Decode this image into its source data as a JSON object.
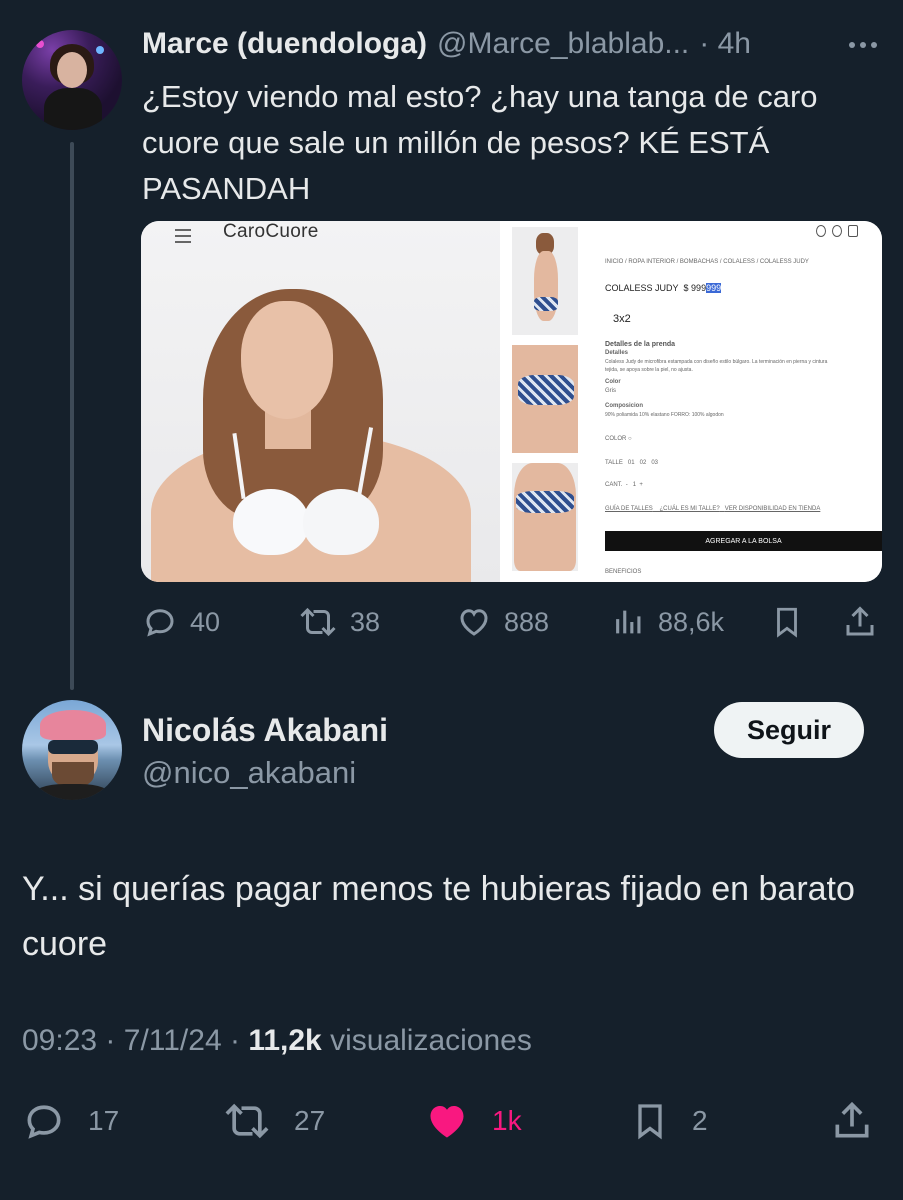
{
  "parent_tweet": {
    "author_name": "Marce (duendologa)",
    "author_handle": "@Marce_blablab...",
    "time": "· 4h",
    "text": "¿Estoy viendo mal esto? ¿hay una tanga de caro cuore que sale un millón de pesos? KÉ ESTÁ PASANDAH",
    "media": {
      "brand": "CaroCuore",
      "breadcrumb": "INICIO / ROPA INTERIOR / BOMBACHAS / COLALESS / COLALESS JUDY",
      "product_name": "COLALESS JUDY",
      "price_prefix": "$ 999",
      "price_highlight": "999",
      "promo": "3x2",
      "details_title": "Detalles de la prenda",
      "details_sub": "Detalles",
      "details_text_1": "Colaless Judy de microfibra estampada con diseño estilo búlgaro. La terminación en pierna y cintura",
      "details_text_2": "tejida, se apoya sobre la piel, no ajusta.",
      "color_label": "Color",
      "color_value": "Gris",
      "composition_label": "Composicion",
      "composition_value": "90% poliamida 10% elastano FORRO: 100% algodon",
      "color_selector": "COLOR",
      "size_label": "TALLE",
      "sizes": [
        "01",
        "02",
        "03"
      ],
      "qty_label": "CANT.",
      "qty_minus": "-",
      "qty_value": "1",
      "qty_plus": "+",
      "link_guide": "GUÍA DE TALLES",
      "link_which_size": "¿CUÁL ES MI TALLE?",
      "link_store": "VER DISPONIBILIDAD EN TIENDA",
      "add_to_bag": "AGREGAR A LA BOLSA",
      "benefits": "BENEFICIOS"
    },
    "actions": {
      "replies": "40",
      "reposts": "38",
      "likes": "888",
      "views": "88,6k"
    }
  },
  "reply_tweet": {
    "author_name": "Nicolás Akabani",
    "author_handle": "@nico_akabani",
    "follow_label": "Seguir",
    "text": "Y... si querías pagar menos te hubieras fijado en barato cuore",
    "time": "09:23",
    "date": "7/11/24",
    "views_count": "11,2k",
    "views_label": "visualizaciones",
    "separator": "·",
    "actions": {
      "replies": "17",
      "reposts": "27",
      "likes": "1k",
      "bookmarks": "2"
    }
  },
  "colors": {
    "background": "#15202b",
    "text": "#e7e9ea",
    "muted": "#8b98a5",
    "like_active": "#f91880"
  }
}
